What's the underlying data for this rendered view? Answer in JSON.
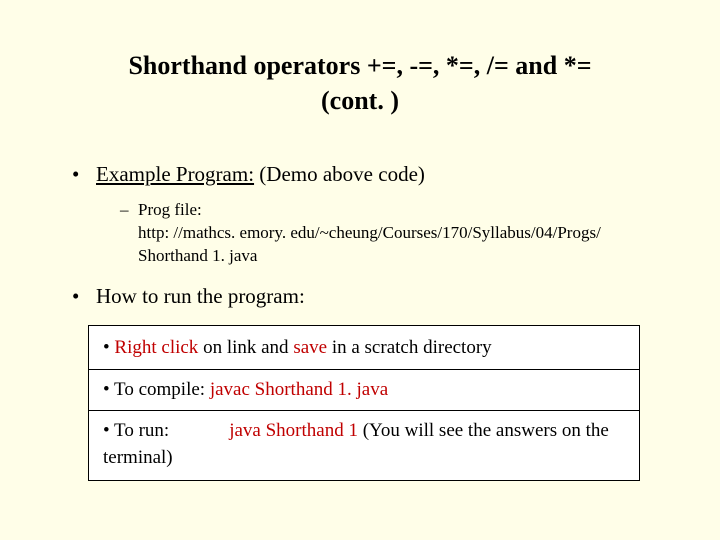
{
  "title": {
    "line1": "Shorthand operators +=, -=, *=, /= and *=",
    "line2": "(cont. )"
  },
  "bullet1": {
    "label": "Example Program:",
    "rest": " (Demo above code)",
    "sub_label": "Prog file:",
    "sub_url": "http: //mathcs. emory. edu/~cheung/Courses/170/Syllabus/04/Progs/ Shorthand 1. java"
  },
  "bullet2": {
    "label": "How to run the program:"
  },
  "box": {
    "row1": {
      "pre": "• ",
      "a": "Right click",
      "mid": " on link and ",
      "b": "save",
      "post": " in a scratch directory"
    },
    "row2": {
      "pre": "• To compile:   ",
      "cmd": "javac Shorthand 1. java"
    },
    "row3": {
      "pre": "• To run:",
      "cmd": "java Shorthand 1",
      "post": " (You will see the answers on the terminal)"
    }
  }
}
